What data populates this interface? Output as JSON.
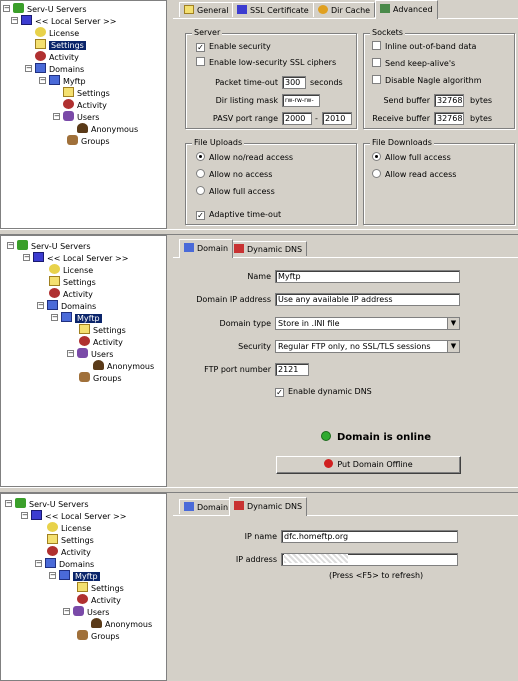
{
  "tree": {
    "servers": "Serv-U Servers",
    "local_server": "<< Local Server >>",
    "license": "License",
    "settings": "Settings",
    "activity": "Activity",
    "domains": "Domains",
    "domain_name": "Myftp",
    "domain_settings": "Settings",
    "domain_activity": "Activity",
    "users": "Users",
    "anonymous": "Anonymous",
    "groups": "Groups"
  },
  "advanced": {
    "tabs": [
      "General",
      "SSL Certificate",
      "Dir Cache",
      "Advanced"
    ],
    "server_group": "Server",
    "enable_security": "Enable security",
    "enable_security_checked": true,
    "low_security_ssl": "Enable low-security SSL ciphers",
    "low_security_ssl_checked": false,
    "packet_timeout_label": "Packet time-out",
    "packet_timeout_value": "300",
    "packet_timeout_unit": "seconds",
    "dir_listing_mask_label": "Dir listing mask",
    "dir_listing_mask_value": "rw-rw-rw-",
    "pasv_port_range_label": "PASV port range",
    "pasv_from": "2000",
    "pasv_sep": "-",
    "pasv_to": "2010",
    "sockets_group": "Sockets",
    "inline_oob": "Inline out-of-band data",
    "send_keepalive": "Send keep-alive's",
    "disable_nagle": "Disable Nagle algorithm",
    "send_buffer_label": "Send buffer",
    "send_buffer_value": "32768",
    "receive_buffer_label": "Receive buffer",
    "receive_buffer_value": "32768",
    "bytes": "bytes",
    "uploads_group": "File Uploads",
    "upload_options": [
      "Allow no/read access",
      "Allow no access",
      "Allow full access"
    ],
    "upload_selected": 0,
    "adaptive_timeout": "Adaptive time-out",
    "adaptive_timeout_checked": true,
    "downloads_group": "File Downloads",
    "download_options": [
      "Allow full access",
      "Allow read access"
    ],
    "download_selected": 0
  },
  "domain_panel": {
    "tabs": [
      "Domain",
      "Dynamic DNS"
    ],
    "name_label": "Name",
    "name_value": "Myftp",
    "ip_label": "Domain IP address",
    "ip_value": "Use any available IP address",
    "type_label": "Domain type",
    "type_value": "Store in .INI file",
    "security_label": "Security",
    "security_value": "Regular FTP only, no SSL/TLS sessions",
    "port_label": "FTP port number",
    "port_value": "2121",
    "dynamic_dns_label": "Enable dynamic DNS",
    "dynamic_dns_checked": true,
    "status": "Domain is online",
    "offline_button": "Put Domain Offline"
  },
  "dns_panel": {
    "tabs": [
      "Domain",
      "Dynamic DNS"
    ],
    "ip_name_label": "IP name",
    "ip_name_value": "dfc.homeftp.org",
    "ip_address_label": "IP address",
    "refresh_hint": "(Press <F5> to refresh)"
  },
  "colors": {
    "selection": "#0a246a",
    "online": "#2faa2f",
    "face": "#d4d0c8"
  }
}
